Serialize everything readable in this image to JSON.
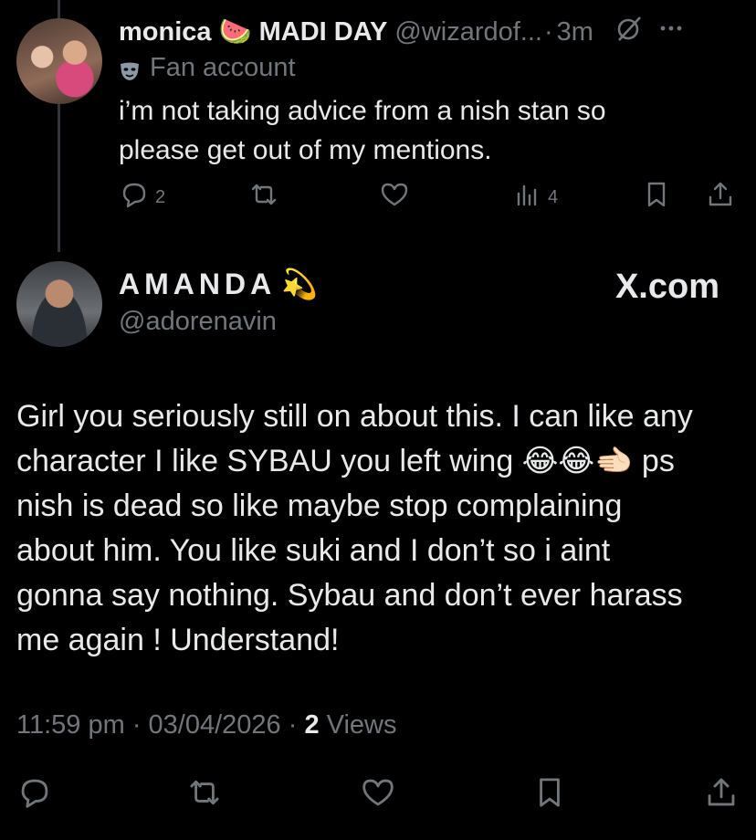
{
  "reply_tweet": {
    "display_name": "monica",
    "name_emoji": "🍉",
    "second_name": "MADI DAY",
    "handle": "@wizardof...",
    "separator": "·",
    "time": "3m",
    "label": "Fan account",
    "text_line1": "i’m not taking advice from a nish stan so",
    "text_line2": "please get out of my mentions.",
    "replies": "2",
    "views": "4"
  },
  "main_tweet": {
    "display_name": "AMANDA",
    "name_emoji": "💫",
    "handle": "@adorenavin",
    "brand": "X.com",
    "lines": [
      "Girl you seriously still on about this. I can like any",
      "character I like SYBAU you left wing 😂😂🫲🏻 ps",
      "nish is dead so like maybe stop complaining",
      "about him. You like suki and I don’t so i aint",
      "gonna say nothing. Sybau and don’t ever harass",
      "me again ! Understand!"
    ],
    "timestamp": "11:59 pm · 03/04/2026 ·",
    "views_count": "2",
    "views_label": "Views"
  },
  "icons": {
    "reply": "reply-icon",
    "retweet": "retweet-icon",
    "like": "like-icon",
    "analytics": "analytics-icon",
    "bookmark": "bookmark-icon",
    "share": "share-icon",
    "more": "more-icon",
    "grok": "grok-icon",
    "mask": "mask-icon"
  },
  "colors": {
    "background": "#000000",
    "text": "#e7e9ea",
    "muted": "#71767b"
  }
}
